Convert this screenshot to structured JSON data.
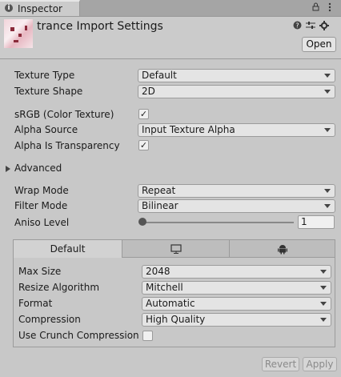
{
  "tab": {
    "icon": "info-icon",
    "label": "Inspector"
  },
  "tab_icons": {
    "lock": "lock-icon",
    "menu": "menu-icon"
  },
  "header": {
    "title": "trance Import Settings",
    "open_label": "Open",
    "icons": [
      "help-icon",
      "settings-sliders-icon",
      "gear-icon"
    ]
  },
  "fields": {
    "texture_type": {
      "label": "Texture Type",
      "value": "Default"
    },
    "texture_shape": {
      "label": "Texture Shape",
      "value": "2D"
    },
    "srgb": {
      "label": "sRGB (Color Texture)",
      "checked": true
    },
    "alpha_source": {
      "label": "Alpha Source",
      "value": "Input Texture Alpha"
    },
    "alpha_transparency": {
      "label": "Alpha Is Transparency",
      "checked": true
    },
    "advanced": {
      "label": "Advanced"
    },
    "wrap_mode": {
      "label": "Wrap Mode",
      "value": "Repeat"
    },
    "filter_mode": {
      "label": "Filter Mode",
      "value": "Bilinear"
    },
    "aniso": {
      "label": "Aniso Level",
      "value": "1",
      "level": 0
    }
  },
  "platform": {
    "tabs": [
      {
        "label": "Default",
        "icon": ""
      },
      {
        "label": "",
        "icon": "monitor-icon"
      },
      {
        "label": "",
        "icon": "android-icon"
      }
    ],
    "max_size": {
      "label": "Max Size",
      "value": "2048"
    },
    "resize": {
      "label": "Resize Algorithm",
      "value": "Mitchell"
    },
    "format": {
      "label": "Format",
      "value": "Automatic"
    },
    "compression": {
      "label": "Compression",
      "value": "High Quality"
    },
    "crunch": {
      "label": "Use Crunch Compression",
      "checked": false
    }
  },
  "footer": {
    "revert_label": "Revert",
    "apply_label": "Apply"
  },
  "check_glyph": "✓"
}
